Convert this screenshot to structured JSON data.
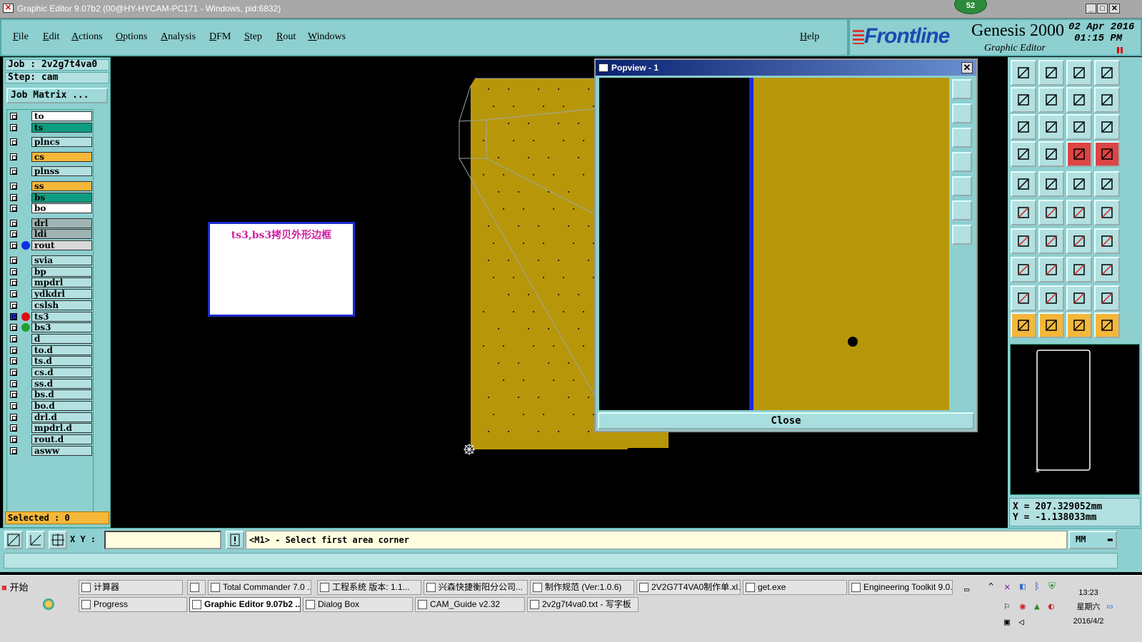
{
  "window": {
    "title": "Graphic Editor 9.07b2 (00@HY-HYCAM-PC171 - Windows, pid:6832)",
    "badge": "52"
  },
  "menubar": {
    "items": [
      "File",
      "Edit",
      "Actions",
      "Options",
      "Analysis",
      "DFM",
      "Step",
      "Rout",
      "Windows"
    ],
    "help": "Help"
  },
  "brand": {
    "logo": "Frontline",
    "product": "Genesis 2000",
    "subtitle": "Graphic Editor",
    "date": "02 Apr 2016",
    "time": "01:15 PM"
  },
  "left_panel": {
    "job": "Job : 2v2g7t4va0",
    "step": "Step: cam",
    "job_matrix": "Job Matrix ...",
    "selected": "Selected : 0",
    "layers": [
      {
        "name": "to",
        "color": "#ffffff"
      },
      {
        "name": "ts",
        "color": "#0e9c80"
      },
      {
        "name": "plncs",
        "color": "#b3e0e0"
      },
      {
        "name": "cs",
        "color": "#f4b73a"
      },
      {
        "name": "plnss",
        "color": "#b3e0e0"
      },
      {
        "name": "ss",
        "color": "#f4b73a"
      },
      {
        "name": "bs",
        "color": "#0e9c80"
      },
      {
        "name": "bo",
        "color": "#ffffff"
      },
      {
        "name": "drl",
        "color": "#a0b4b4"
      },
      {
        "name": "ldi",
        "color": "#a0b4b4"
      },
      {
        "name": "rout",
        "color": "#d8d8d8",
        "dot": "#1030e0"
      },
      {
        "name": "svia",
        "color": "#b3e0e0"
      },
      {
        "name": "bp",
        "color": "#b3e0e0"
      },
      {
        "name": "mpdrl",
        "color": "#b3e0e0"
      },
      {
        "name": "ydkdrl",
        "color": "#b3e0e0"
      },
      {
        "name": "cslsh",
        "color": "#b3e0e0"
      },
      {
        "name": "ts3",
        "color": "#b3e0e0",
        "dot": "#e01010"
      },
      {
        "name": "bs3",
        "color": "#b3e0e0",
        "dot": "#20a030"
      },
      {
        "name": "d",
        "color": "#b3e0e0"
      },
      {
        "name": "to.d",
        "color": "#b3e0e0"
      },
      {
        "name": "ts.d",
        "color": "#b3e0e0"
      },
      {
        "name": "cs.d",
        "color": "#b3e0e0"
      },
      {
        "name": "ss.d",
        "color": "#b3e0e0"
      },
      {
        "name": "bs.d",
        "color": "#b3e0e0"
      },
      {
        "name": "bo.d",
        "color": "#b3e0e0"
      },
      {
        "name": "drl.d",
        "color": "#b3e0e0"
      },
      {
        "name": "mpdrl.d",
        "color": "#b3e0e0"
      },
      {
        "name": "rout.d",
        "color": "#b3e0e0"
      },
      {
        "name": "asww",
        "color": "#b3e0e0"
      }
    ]
  },
  "annotation": {
    "text": "ts3,bs3拷贝外形边框"
  },
  "popview": {
    "title": "Popview - 1",
    "close_label": "Close"
  },
  "coords": {
    "x": "X = 207.329052mm",
    "y": "Y = -1.138033mm"
  },
  "status": {
    "xy_label": "X Y :",
    "message": "<M1> - Select first area corner",
    "unit": "MM"
  },
  "taskbar": {
    "start": "开始",
    "row1": [
      "计算器",
      "Total Commander 7.0 ...",
      "工程系统  版本: 1.1...",
      "兴森快捷衡阳分公司...",
      "制作规范 (Ver:1.0.6)",
      "2V2G7T4VA0制作单.xl...",
      "get.exe",
      "Engineering Toolkit 9.0..."
    ],
    "row2": [
      "Progress",
      "Graphic Editor 9.07b2 ...",
      "Dialog Box",
      "CAM_Guide v2.32",
      "2v2g7t4va0.txt - 写字板"
    ],
    "clock_time": "13:23",
    "clock_day": "星期六",
    "clock_date": "2016/4/2"
  }
}
